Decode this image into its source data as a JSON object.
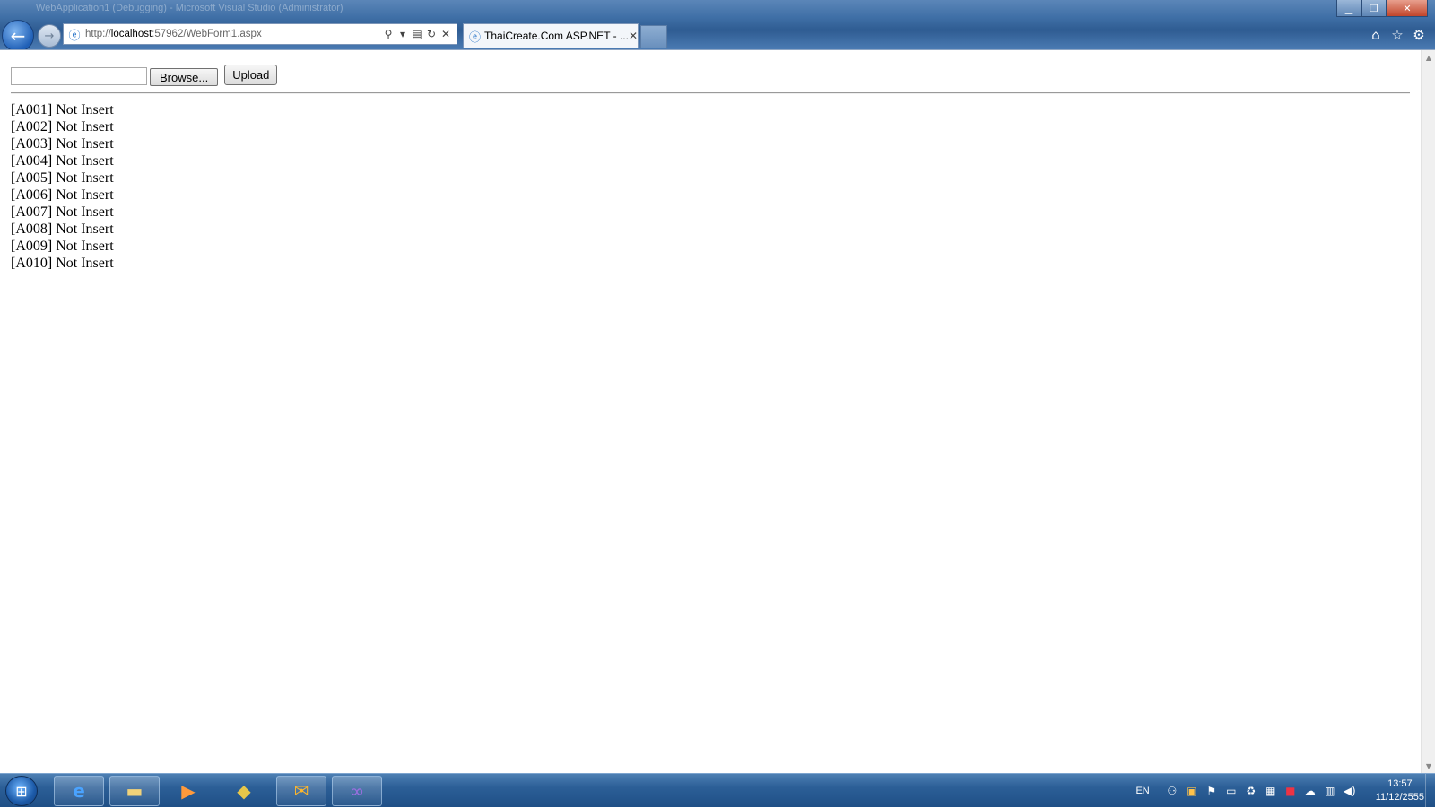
{
  "window": {
    "title": "WebApplication1 (Debugging) - Microsoft Visual Studio (Administrator)"
  },
  "browser": {
    "address_url_prefix": "http://",
    "address_url_host": "localhost",
    "address_url_rest": ":57962/WebForm1.aspx",
    "tab_label": "ThaiCreate.Com ASP.NET - ...",
    "icons": {
      "back": "back-arrow-icon",
      "forward": "forward-arrow-icon",
      "page": "ie-page-icon",
      "search": "search-icon",
      "compat": "compatibility-view-icon",
      "refresh": "refresh-icon",
      "stop": "stop-icon",
      "home": "home-icon",
      "favorites": "star-icon",
      "tools": "gear-icon"
    }
  },
  "form": {
    "file_value": "",
    "browse_label": "Browse...",
    "upload_label": "Upload"
  },
  "results": [
    "[A001] Not Insert",
    "[A002] Not Insert",
    "[A003] Not Insert",
    "[A004] Not Insert",
    "[A005] Not Insert",
    "[A006] Not Insert",
    "[A007] Not Insert",
    "[A008] Not Insert",
    "[A009] Not Insert",
    "[A010] Not Insert"
  ],
  "taskbar": {
    "apps": [
      "internet-explorer",
      "windows-explorer",
      "media-player",
      "sql-server",
      "outlook",
      "visual-studio"
    ],
    "language": "EN",
    "time": "13:57",
    "date": "11/12/2555"
  },
  "colors": {
    "chrome": "#3f6fa6",
    "taskbar": "#2c5f97"
  }
}
